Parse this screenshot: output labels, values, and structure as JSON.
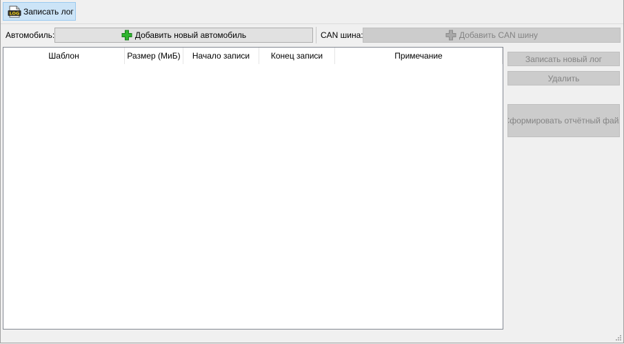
{
  "toolbar": {
    "write_log_label": "Записать лог",
    "log_icon_text": "LOG"
  },
  "car": {
    "label": "Автомобиль:",
    "add_button_label": "Добавить новый автомобиль"
  },
  "can": {
    "label": "CAN шина:",
    "add_button_label": "Добавить CAN шину"
  },
  "table": {
    "columns": [
      "Шаблон",
      "Размер (МиБ)",
      "Начало записи",
      "Конец записи",
      "Примечание"
    ],
    "rows": []
  },
  "actions": {
    "write_new_log_label": "Записать новый лог",
    "delete_label": "Удалить",
    "generate_report_label": "Сформировать отчётный файл"
  },
  "colors": {
    "accent_selected": "#cce4f7",
    "plus_enabled": "#22a322",
    "plus_disabled": "#9a9a9a"
  },
  "icons": {
    "toolbar_icon": "log-file-icon",
    "add_icon": "plus-icon",
    "resize_icon": "size-grip-icon"
  }
}
